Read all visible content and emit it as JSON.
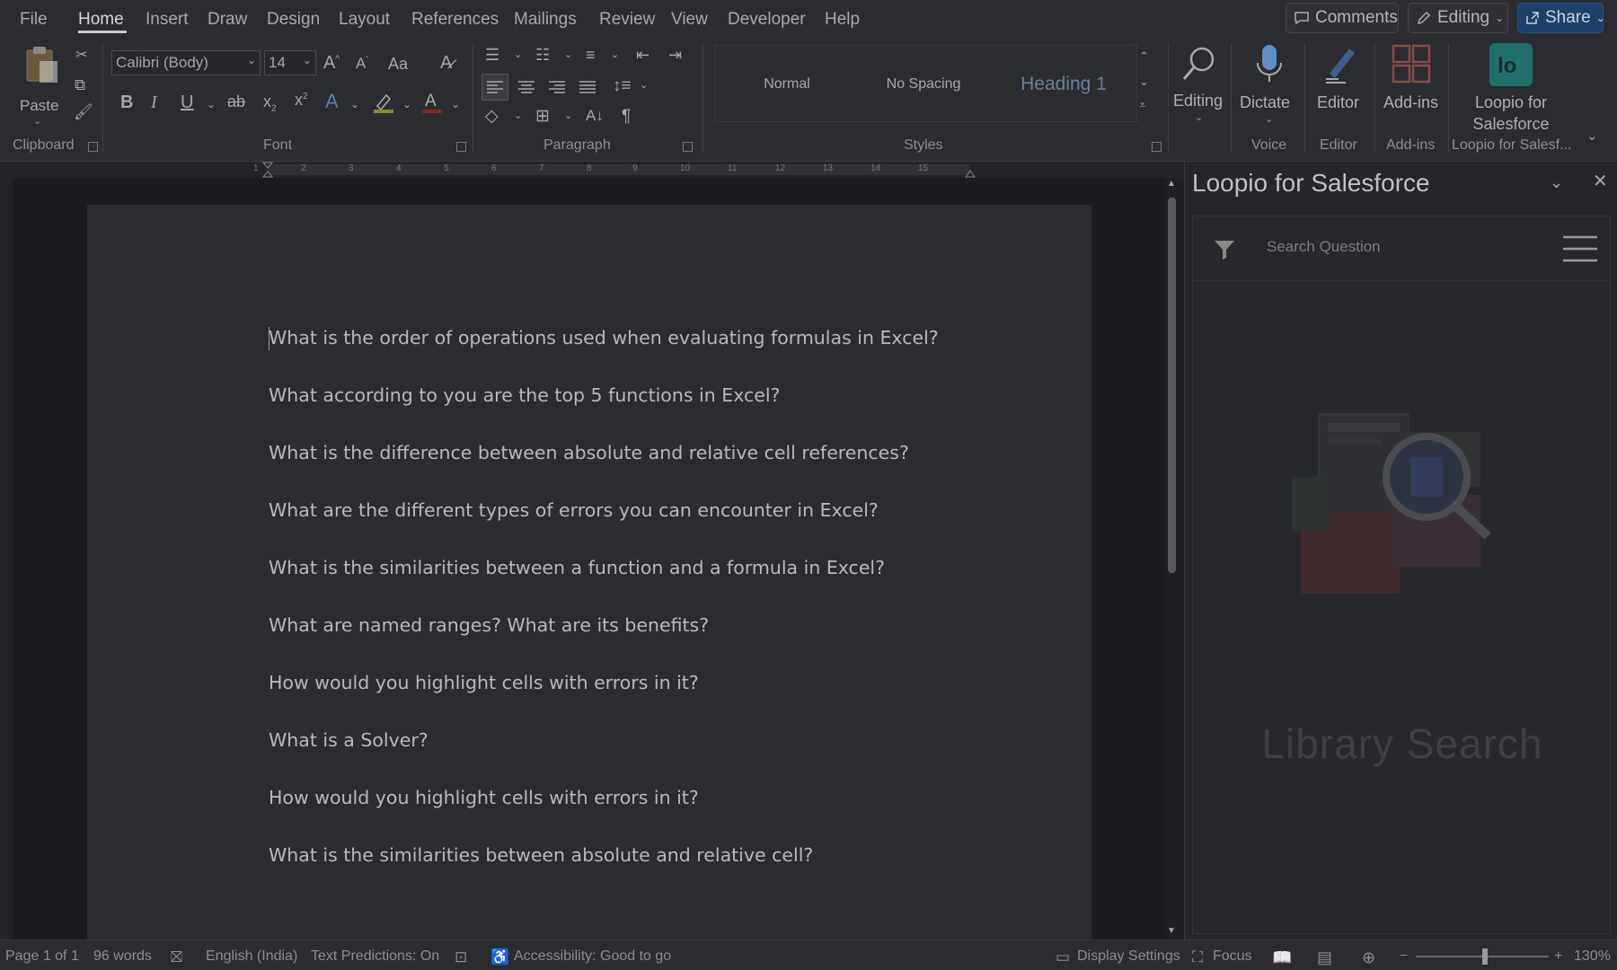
{
  "menu": {
    "items": [
      "File",
      "Home",
      "Insert",
      "Draw",
      "Design",
      "Layout",
      "References",
      "Mailings",
      "Review",
      "View",
      "Developer",
      "Help"
    ],
    "active": "Home",
    "comments_label": "Comments",
    "editing_label": "Editing",
    "share_label": "Share"
  },
  "ribbon": {
    "clipboard": {
      "paste_label": "Paste",
      "group_label": "Clipboard"
    },
    "font": {
      "font_name": "Calibri (Body)",
      "font_size": "14",
      "change_case": "Aa",
      "group_label": "Font"
    },
    "paragraph": {
      "group_label": "Paragraph"
    },
    "styles": {
      "items": [
        "Normal",
        "No Spacing",
        "Heading 1"
      ],
      "group_label": "Styles"
    },
    "editing": {
      "label": "Editing"
    },
    "voice": {
      "label": "Dictate",
      "group_label": "Voice"
    },
    "editor": {
      "label": "Editor",
      "group_label": "Editor"
    },
    "addins": {
      "label": "Add-ins",
      "group_label": "Add-ins"
    },
    "loopio": {
      "label_line1": "Loopio for",
      "label_line2": "Salesforce",
      "group_label": "Loopio for Salesf..."
    }
  },
  "document": {
    "questions": [
      "What is the order of operations used when evaluating formulas in Excel?",
      "What according to you are the top 5 functions in Excel?",
      "What is the difference between absolute and relative cell references?",
      "What are the different types of errors you can encounter in Excel?",
      "What is the similarities between a function and a formula in Excel?",
      "What are named ranges? What are its benefits?",
      "How would you highlight cells with errors in it?",
      "What is a Solver?",
      "How would you highlight cells with errors in it?",
      "What is the similarities between absolute and relative cell?"
    ]
  },
  "pane": {
    "title": "Loopio for Salesforce",
    "search_placeholder": "Search Question",
    "library_title": "Library Search"
  },
  "status": {
    "page": "Page 1 of 1",
    "words": "96 words",
    "language": "English (India)",
    "predictions": "Text Predictions: On",
    "accessibility": "Accessibility: Good to go",
    "display_settings": "Display Settings",
    "focus": "Focus",
    "zoom": "130%"
  },
  "colors": {
    "accent_share": "#19416c",
    "loopio_teal": "#1f6f6b",
    "dictate_blue": "#5d8fc4"
  }
}
